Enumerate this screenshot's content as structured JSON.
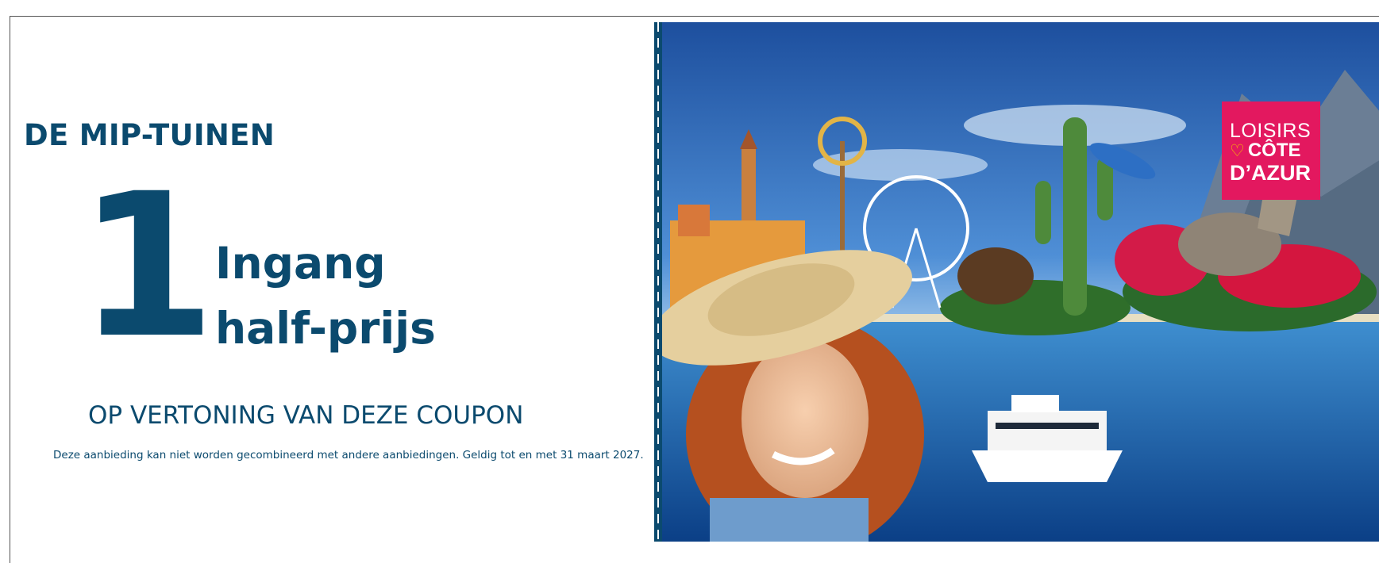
{
  "coupon": {
    "venue": "DE MIP-TUINEN",
    "quantity": "1",
    "offer_line1": "Ingang",
    "offer_line2": "half-prijs",
    "condition": "OP VERTONING VAN DEZE COUPON",
    "fineprint": "Deze aanbieding kan niet worden gecombineerd met andere aanbiedingen. Geldig tot en met 31 maart 2027."
  },
  "logo": {
    "line1": "LOISIRS",
    "line2": "CÔTE",
    "line3": "D’AZUR",
    "icon": "heart-icon",
    "bg_color": "#e3185f",
    "heart_color": "#f5c400"
  },
  "colors": {
    "primary_text": "#0b4a6e",
    "perforation": "#0b4a6e"
  }
}
